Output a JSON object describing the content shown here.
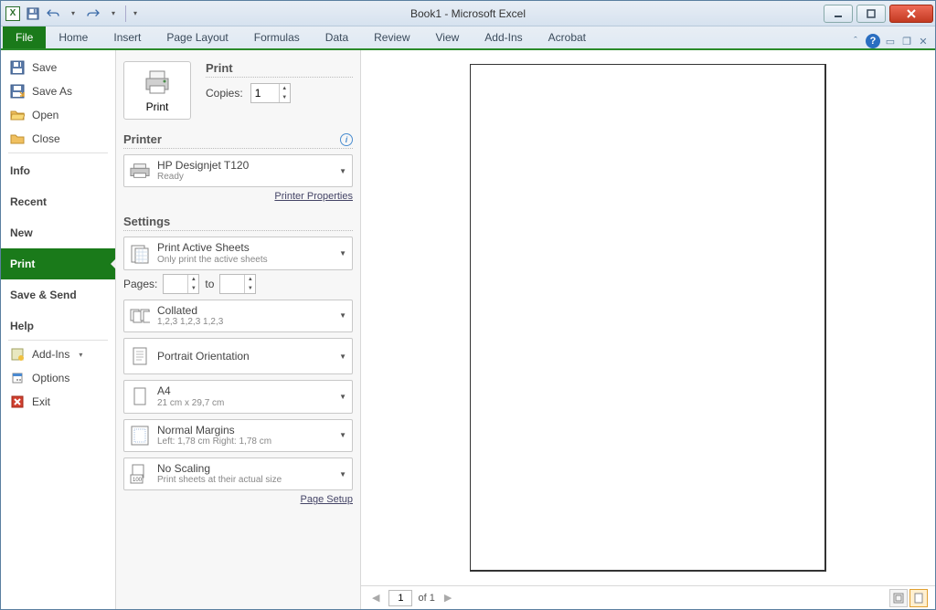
{
  "title": "Book1 - Microsoft Excel",
  "ribbon_tabs": [
    "File",
    "Home",
    "Insert",
    "Page Layout",
    "Formulas",
    "Data",
    "Review",
    "View",
    "Add-Ins",
    "Acrobat"
  ],
  "sidebar": {
    "save": "Save",
    "save_as": "Save As",
    "open": "Open",
    "close": "Close",
    "info": "Info",
    "recent": "Recent",
    "new": "New",
    "print": "Print",
    "save_send": "Save & Send",
    "help": "Help",
    "addins": "Add-Ins",
    "options": "Options",
    "exit": "Exit"
  },
  "print": {
    "heading": "Print",
    "print_btn": "Print",
    "copies_label": "Copies:",
    "copies_value": "1",
    "printer_heading": "Printer",
    "printer_name": "HP Designjet T120",
    "printer_status": "Ready",
    "printer_props": "Printer Properties",
    "settings_heading": "Settings",
    "scope_title": "Print Active Sheets",
    "scope_sub": "Only print the active sheets",
    "pages_label": "Pages:",
    "to_label": "to",
    "collate_title": "Collated",
    "collate_sub": "1,2,3    1,2,3    1,2,3",
    "orient": "Portrait Orientation",
    "paper_title": "A4",
    "paper_sub": "21 cm x 29,7 cm",
    "margins_title": "Normal Margins",
    "margins_sub": "Left: 1,78 cm   Right: 1,78 cm",
    "scaling_title": "No Scaling",
    "scaling_sub": "Print sheets at their actual size",
    "page_setup": "Page Setup"
  },
  "preview": {
    "current": "1",
    "total": "of 1"
  }
}
